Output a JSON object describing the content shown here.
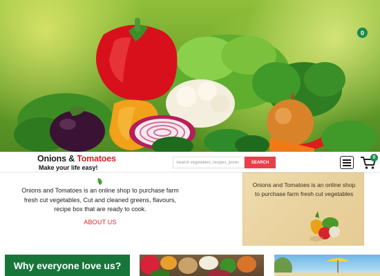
{
  "hero": {
    "cart_count": "0"
  },
  "header": {
    "brand_part1": "Onions",
    "brand_amp": " & ",
    "brand_part2": "Tomatoes",
    "tagline": "Make your life easy!",
    "search_placeholder": "Search vegetables, recipes, juices",
    "search_button": "SEARCH",
    "cart_count": "0"
  },
  "about": {
    "description": "Onions and Tomatoes is an online shop to purchase farm fresh cut vegetables, Cut and cleaned greens, flavours, recipe box that are ready to cook.",
    "link": "ABOUT US"
  },
  "promo": {
    "text": "Onions and Tomatoes is an online shop to purchase farm fresh cut vegetables"
  },
  "bottom": {
    "why_title": "Why everyone love us?"
  },
  "icons": {
    "menu": "hamburger-icon",
    "cart": "cart-icon",
    "leaf": "leaf-icon"
  },
  "colors": {
    "brand_red": "#d6232b",
    "search_red": "#e8404b",
    "green": "#17753a",
    "badge_green": "#1a8a4a"
  }
}
